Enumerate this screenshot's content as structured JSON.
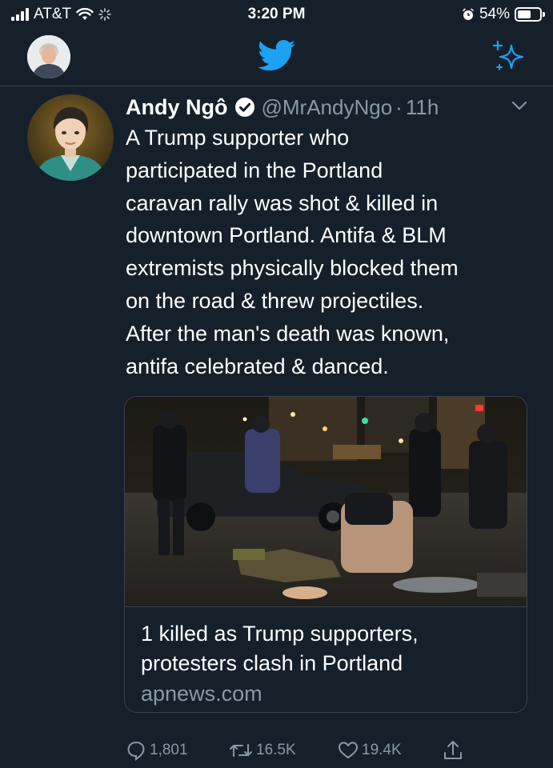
{
  "status_bar": {
    "carrier": "AT&T",
    "time": "3:20 PM",
    "battery": "54%",
    "battery_level": 0.54
  },
  "nav": {
    "logo_icon": "twitter-bird-icon",
    "top_tweets_icon": "sparkle-icon"
  },
  "tweet": {
    "display_name": "Andy Ngô",
    "handle": "@MrAndyNgo",
    "separator": "·",
    "time": "11h",
    "text": "A Trump supporter who\nparticipated in the Portland\ncaravan rally was shot & killed in\ndowntown Portland. Antifa & BLM\nextremists physically blocked them\non the road & threw projectiles.\nAfter the man's death was known,\nantifa celebrated & danced.",
    "card": {
      "title": "1 killed as Trump supporters,\nprotesters clash in Portland",
      "domain": "apnews.com"
    },
    "actions": {
      "replies": "1,801",
      "retweets": "16.5K",
      "likes": "19.4K"
    }
  },
  "colors": {
    "background": "#15202b",
    "secondary_text": "#8899a6",
    "accent": "#1da1f2",
    "border": "#38444d"
  }
}
